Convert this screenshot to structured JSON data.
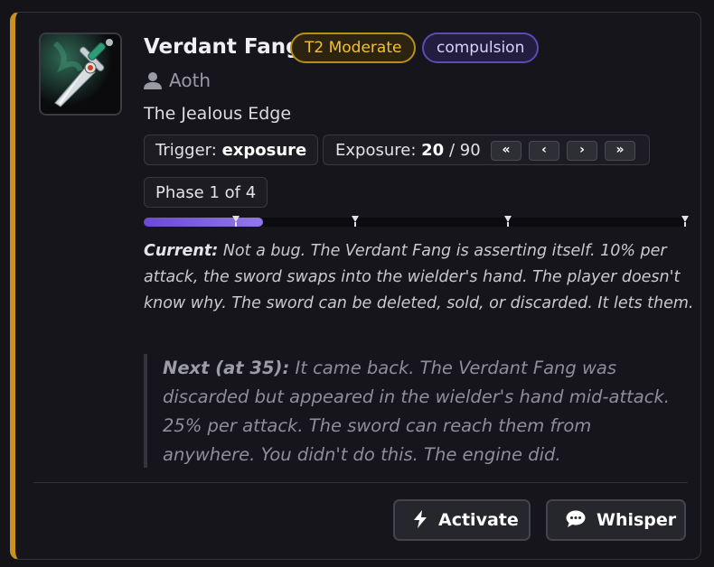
{
  "item": {
    "name": "Verdant Fang",
    "tier_badge": "T2 Moderate",
    "tag_badge": "compulsion",
    "owner": "Aoth",
    "subtitle": "The Jealous Edge",
    "icon": "dagger-icon"
  },
  "trigger": {
    "label": "Trigger:",
    "value": "exposure"
  },
  "exposure": {
    "label": "Exposure:",
    "current": "20",
    "separator": "/",
    "max": "90",
    "buttons": [
      "«",
      "‹",
      "›",
      "»"
    ]
  },
  "phase": {
    "label": "Phase 1 of 4"
  },
  "progress": {
    "fraction": 0.22
  },
  "current_text": {
    "label": "Current:",
    "body": "Not a bug. The Verdant Fang is asserting itself. 10% per attack, the sword swaps into the wielder's hand. The player doesn't know why. The sword can be deleted, sold, or discarded. It lets them."
  },
  "next_text": {
    "label": "Next (at 35):",
    "body": "It came back. The Verdant Fang was discarded but appeared in the wielder's hand mid-attack. 25% per attack. The sword can reach them from anywhere. You didn't do this. The engine did."
  },
  "actions": {
    "activate": {
      "label": "Activate",
      "icon": "lightning-icon"
    },
    "whisper": {
      "label": "Whisper",
      "icon": "speech-bubble-icon"
    }
  },
  "colors": {
    "accent_border": "#c9921e",
    "tier_badge": "#f2c12e",
    "tag_badge": "#5f49b3",
    "progress": "#7b5ddb"
  }
}
